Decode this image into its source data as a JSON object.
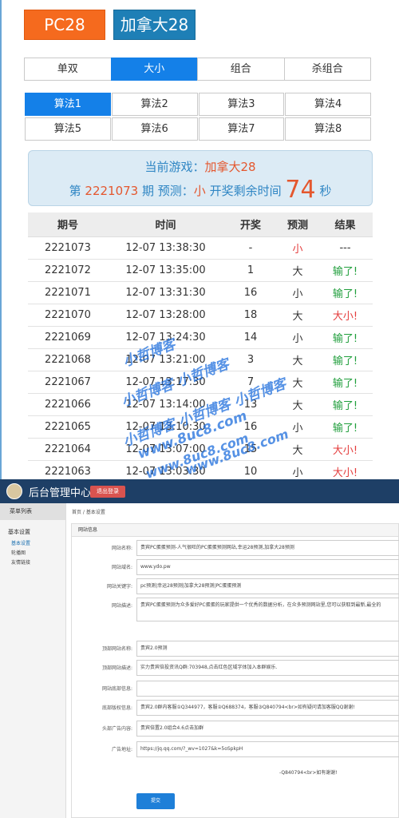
{
  "tabs": {
    "pc28": "PC28",
    "canada28": "加拿大28"
  },
  "bet_types": [
    "单双",
    "大小",
    "组合",
    "杀组合"
  ],
  "algorithms": [
    "算法1",
    "算法2",
    "算法3",
    "算法4",
    "算法5",
    "算法6",
    "算法7",
    "算法8"
  ],
  "info": {
    "current_game_label": "当前游戏：",
    "current_game": "加拿大28",
    "period_prefix": "第",
    "period": "2221073",
    "period_mid": "期 预测：",
    "prediction": "小",
    "countdown_label": "开奖剩余时间",
    "countdown": "74",
    "countdown_unit": "秒"
  },
  "table": {
    "headers": [
      "期号",
      "时间",
      "开奖",
      "预测",
      "结果"
    ],
    "rows": [
      [
        "2221073",
        "12-07 13:38:30",
        "-",
        "小",
        "---"
      ],
      [
        "2221072",
        "12-07 13:35:00",
        "1",
        "大",
        "输了!"
      ],
      [
        "2221071",
        "12-07 13:31:30",
        "16",
        "小",
        "输了!"
      ],
      [
        "2221070",
        "12-07 13:28:00",
        "18",
        "大",
        "大小!"
      ],
      [
        "2221069",
        "12-07 13:24:30",
        "14",
        "小",
        "输了!"
      ],
      [
        "2221068",
        "12-07 13:21:00",
        "3",
        "大",
        "输了!"
      ],
      [
        "2221067",
        "12-07 13:17:30",
        "7",
        "大",
        "输了!"
      ],
      [
        "2221066",
        "12-07 13:14:00",
        "13",
        "大",
        "输了!"
      ],
      [
        "2221065",
        "12-07 13:10:30",
        "16",
        "小",
        "输了!"
      ],
      [
        "2221064",
        "12-07 13:07:00",
        "15",
        "大",
        "大小!"
      ],
      [
        "2221063",
        "12-07 13:03:30",
        "10",
        "小",
        "大小!"
      ]
    ]
  },
  "watermark": [
    "小哲博客",
    "小哲博客 小哲博客",
    "小哲博客 小哲博客 小哲博客",
    "www.8uc8.com",
    "www.8uc8.com",
    "www.8uc8.com"
  ],
  "admin": {
    "title": "后台管理中心",
    "logout": "退出登录",
    "menu_header": "菜单列表",
    "section": "基本设置",
    "items": [
      "基本设置",
      "轮播图",
      "友情链接"
    ],
    "breadcrumb": "首页 / 基本设置",
    "panel_title": "网站信息",
    "fields": [
      {
        "label": "网站名称:",
        "value": "贵宾PC蛋蛋预测-人气很旺的PC蛋蛋预测网站,幸运28预测,加拿大28预测"
      },
      {
        "label": "网站域名:",
        "value": "www.ydo.pw"
      },
      {
        "label": "网站关键字:",
        "value": "pc预测|幸运28预测|加拿大28预测|PC蛋蛋预测"
      },
      {
        "label": "网站描述:",
        "value": "贵宾PC蛋蛋预测为众多爱好PC蛋蛋的玩家提供一个优秀的数据分析，在众多预测网站里,您可以获取到最新,最全的"
      },
      {
        "label": "顶部网站名称:",
        "value": "贵宾2.0预测"
      },
      {
        "label": "顶部网站描述:",
        "value": "实力贵宾倍投资讯Q群:703948,点击红色区域字体加入本群娱乐."
      },
      {
        "label": "网站底部信息:",
        "value": ""
      },
      {
        "label": "底部版权信息:",
        "value": "贵宾2.0群内客服①Q344977，客服②Q688374，客服③Q840794<br>如有疑问请加客服QQ谢谢!"
      },
      {
        "label": "头部广告内容:",
        "value": "贵宾倍置2.0组合4.6点击加群"
      },
      {
        "label": "广告地址:",
        "value": "https://jq.qq.com/?_wv=1027&k=5oSpkpH"
      }
    ],
    "overflow_text": "-Q840794<br>如有谢谢!",
    "submit": "提交"
  }
}
